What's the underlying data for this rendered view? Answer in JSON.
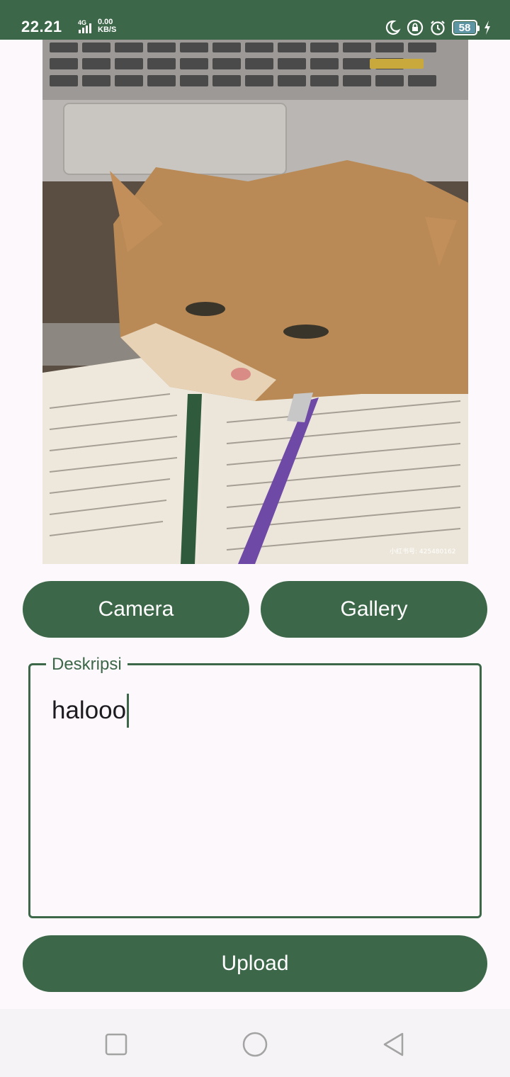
{
  "status_bar": {
    "time": "22.21",
    "network": "4G",
    "speed_value": "0.00",
    "speed_unit": "KB/S",
    "battery": "58",
    "icons": [
      "moon-icon",
      "lock-icon",
      "alarm-icon",
      "battery-icon",
      "charging-icon"
    ],
    "color": "#3c6849"
  },
  "photo": {
    "watermark": "小红书号: 425480162"
  },
  "buttons": {
    "camera": "Camera",
    "gallery": "Gallery",
    "upload": "Upload"
  },
  "description_field": {
    "label": "Deskripsi",
    "value": "halooo"
  },
  "nav_bar": {
    "icons": [
      "recent-apps-icon",
      "home-icon",
      "back-icon"
    ]
  },
  "colors": {
    "accent": "#3c6849",
    "background": "#fdf8fc",
    "button_text": "#ffffff"
  }
}
